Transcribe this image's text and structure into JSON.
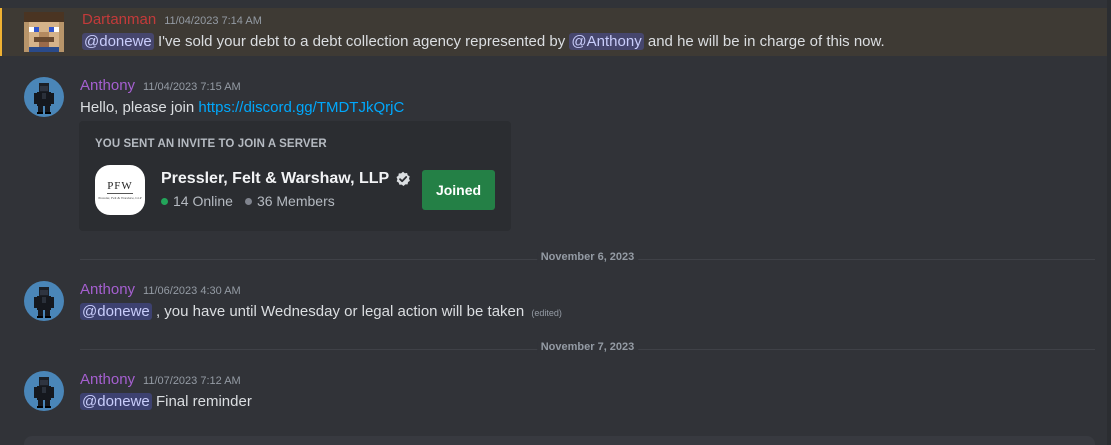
{
  "messages": [
    {
      "username": "Dartanman",
      "username_color": "#c33a3a",
      "timestamp": "11/04/2023 7:14 AM",
      "mention1": "@donewe",
      "text1": "I've sold your debt to a debt collection agency represented by",
      "mention2": "@Anthony",
      "text2": "and he will be in charge of this now."
    },
    {
      "username": "Anthony",
      "username_color": "#a55fd0",
      "timestamp": "11/04/2023 7:15 AM",
      "text": "Hello, please join",
      "link": "https://discord.gg/TMDTJkQrjC"
    },
    {
      "username": "Anthony",
      "username_color": "#a55fd0",
      "timestamp": "11/06/2023 4:30 AM",
      "mention": "@donewe",
      "text": ", you have until Wednesday or legal action will be taken",
      "edited": "(edited)"
    },
    {
      "username": "Anthony",
      "username_color": "#a55fd0",
      "timestamp": "11/07/2023 7:12 AM",
      "mention": "@donewe",
      "text": "Final reminder"
    }
  ],
  "invite": {
    "title": "YOU SENT AN INVITE TO JOIN A SERVER",
    "icon_text": "PFW",
    "icon_subtext": "Pressler, Felt & Warshaw, LLP",
    "server_name": "Pressler, Felt & Warshaw, LLP",
    "online": "14 Online",
    "members": "36 Members",
    "button_label": "Joined",
    "button_color": "#248046"
  },
  "dividers": {
    "first": "November 6, 2023",
    "second": "November 7, 2023"
  },
  "icons": {
    "verified": "verified-badge-icon",
    "avatar1": "pixel-face-avatar",
    "avatar2": "pixel-character-avatar"
  }
}
